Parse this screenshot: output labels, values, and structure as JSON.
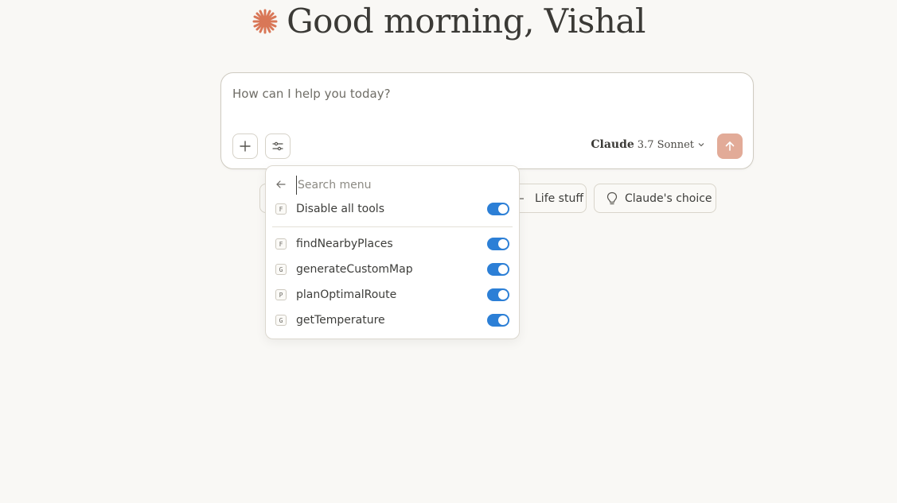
{
  "greeting": {
    "text": "Good morning, Vishal",
    "icon": "claude-spark-icon",
    "icon_color": "#d97757"
  },
  "composer": {
    "placeholder": "How can I help you today?",
    "value": "",
    "add_button_icon": "plus-icon",
    "tools_button_icon": "sliders-icon",
    "model": {
      "name": "Claude",
      "version": "3.7 Sonnet"
    },
    "send_icon": "arrow-up-icon",
    "send_color": "#e2ab98"
  },
  "suggestions": [
    {
      "label": "Life stuff",
      "icon": "spark-icon"
    },
    {
      "label": "Claude's choice",
      "icon": "lightbulb-icon"
    }
  ],
  "tools_menu": {
    "search_placeholder": "Search menu",
    "back_icon": "arrow-left-icon",
    "disable_all": {
      "badge": "F",
      "label": "Disable all tools",
      "enabled": true
    },
    "tools": [
      {
        "badge": "F",
        "label": "findNearbyPlaces",
        "enabled": true
      },
      {
        "badge": "G",
        "label": "generateCustomMap",
        "enabled": true
      },
      {
        "badge": "P",
        "label": "planOptimalRoute",
        "enabled": true
      },
      {
        "badge": "G",
        "label": "getTemperature",
        "enabled": true
      }
    ],
    "toggle_color": "#2c7fd6"
  }
}
